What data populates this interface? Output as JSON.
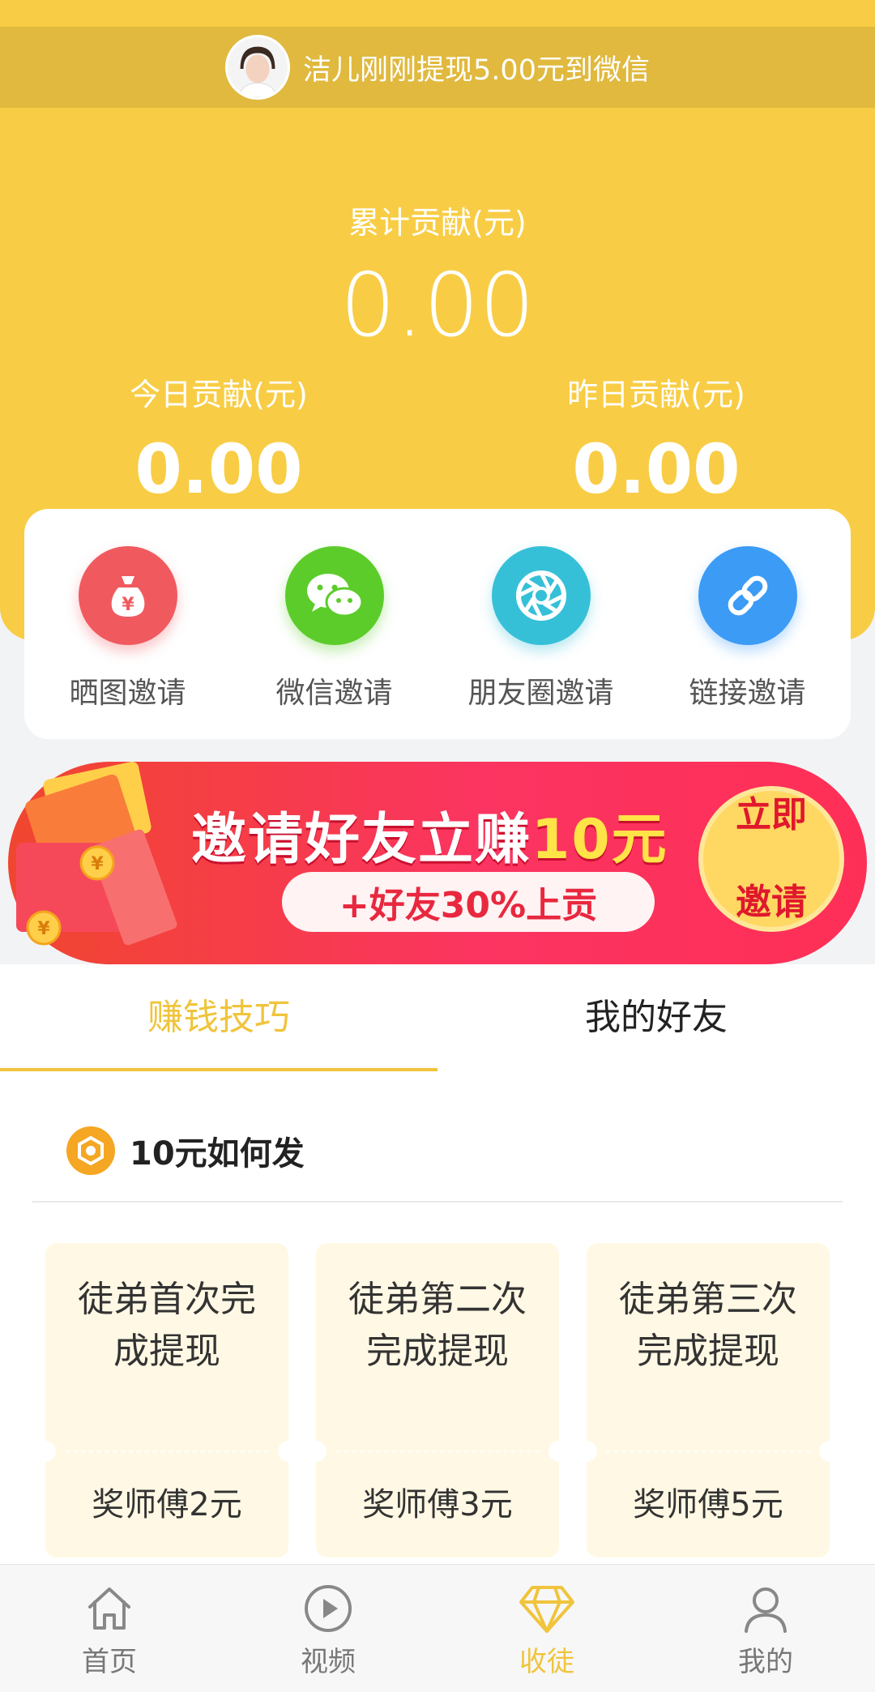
{
  "ticker": {
    "text": "洁儿刚刚提现5.00元到微信"
  },
  "stats": {
    "total_label": "累计贡献(元)",
    "total_value": "0.00",
    "today_label": "今日贡献(元)",
    "today_value": "0.00",
    "yesterday_label": "昨日贡献(元)",
    "yesterday_value": "0.00"
  },
  "invite": {
    "items": [
      {
        "label": "晒图邀请",
        "icon": "money-bag-icon",
        "color": "#f05a5f"
      },
      {
        "label": "微信邀请",
        "icon": "wechat-icon",
        "color": "#5ccc2a"
      },
      {
        "label": "朋友圈邀请",
        "icon": "aperture-icon",
        "color": "#36c0d8"
      },
      {
        "label": "链接邀请",
        "icon": "link-icon",
        "color": "#3b9bf5"
      }
    ]
  },
  "banner": {
    "headline_prefix": "邀请好友立赚",
    "headline_amount": "10元",
    "sub": "+好友30%上贡",
    "cta_line1": "立即",
    "cta_line2": "邀请"
  },
  "tabs": [
    {
      "label": "赚钱技巧",
      "active": true
    },
    {
      "label": "我的好友",
      "active": false
    }
  ],
  "section": {
    "title": "10元如何发"
  },
  "rewards": [
    {
      "line1": "徒弟首次完",
      "line2": "成提现",
      "bonus": "奖师傅2元"
    },
    {
      "line1": "徒弟第二次",
      "line2": "完成提现",
      "bonus": "奖师傅3元"
    },
    {
      "line1": "徒弟第三次",
      "line2": "完成提现",
      "bonus": "奖师傅5元"
    }
  ],
  "nav": [
    {
      "label": "首页",
      "icon": "home-icon",
      "active": false
    },
    {
      "label": "视频",
      "icon": "video-icon",
      "active": false
    },
    {
      "label": "收徒",
      "icon": "diamond-icon",
      "active": true
    },
    {
      "label": "我的",
      "icon": "user-icon",
      "active": false
    }
  ],
  "colors": {
    "header": "#f8cd45",
    "accent": "#f0c43c",
    "banner_red": "#fb3461"
  }
}
